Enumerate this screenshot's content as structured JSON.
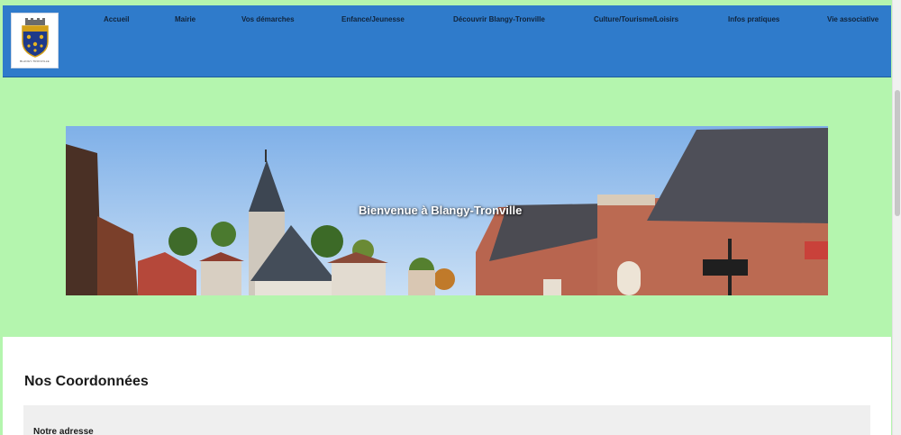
{
  "header": {
    "logo_caption": "BLANGY-TRONVILLE",
    "nav": [
      {
        "label": "Accueil"
      },
      {
        "label": "Mairie"
      },
      {
        "label": "Vos démarches"
      },
      {
        "label": "Enfance/Jeunesse"
      },
      {
        "label": "Découvrir Blangy-Tronville"
      },
      {
        "label": "Culture/Tourisme/Loisirs"
      },
      {
        "label": "Infos pratiques"
      },
      {
        "label": "Vie associative"
      }
    ]
  },
  "banner": {
    "title": "Bienvenue à Blangy-Tronville"
  },
  "content": {
    "section_title": "Nos Coordonnées",
    "address_label": "Notre adresse"
  },
  "colors": {
    "page_background": "#b4f5ae",
    "header_background": "#2f7bcb",
    "nav_text": "#10243c"
  }
}
